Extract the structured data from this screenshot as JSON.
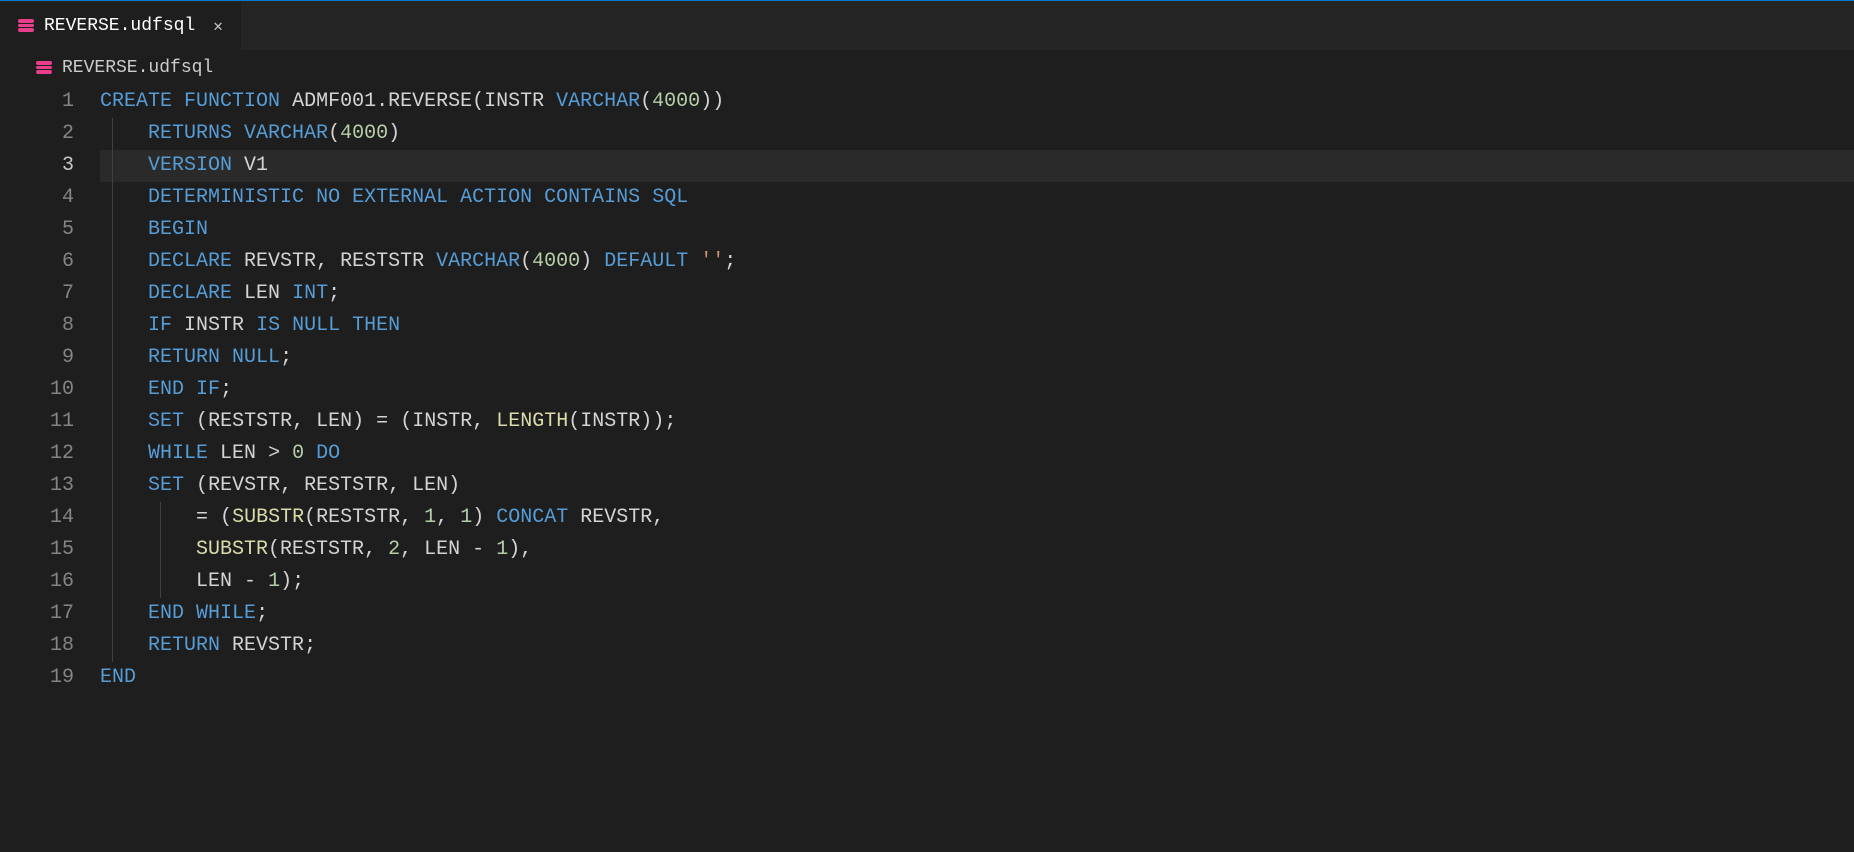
{
  "tab": {
    "filename": "REVERSE.udfsql"
  },
  "breadcrumb": {
    "filename": "REVERSE.udfsql"
  },
  "activeLine": 3,
  "code": {
    "lines": [
      {
        "n": 1,
        "tokens": [
          [
            "kw",
            "CREATE"
          ],
          [
            "sp",
            " "
          ],
          [
            "kw",
            "FUNCTION"
          ],
          [
            "sp",
            " "
          ],
          [
            "id",
            "ADMF001.REVERSE"
          ],
          [
            "punc",
            "("
          ],
          [
            "id",
            "INSTR"
          ],
          [
            "sp",
            " "
          ],
          [
            "ty",
            "VARCHAR"
          ],
          [
            "punc",
            "("
          ],
          [
            "num",
            "4000"
          ],
          [
            "punc",
            ")"
          ],
          [
            "punc",
            ")"
          ]
        ]
      },
      {
        "n": 2,
        "indent": 4,
        "guides": [
          1
        ],
        "tokens": [
          [
            "kw",
            "RETURNS"
          ],
          [
            "sp",
            " "
          ],
          [
            "ty",
            "VARCHAR"
          ],
          [
            "punc",
            "("
          ],
          [
            "num",
            "4000"
          ],
          [
            "punc",
            ")"
          ]
        ]
      },
      {
        "n": 3,
        "indent": 4,
        "guides": [
          1
        ],
        "highlight": true,
        "tokens": [
          [
            "kw",
            "VERSION"
          ],
          [
            "sp",
            " "
          ],
          [
            "id",
            "V1"
          ]
        ]
      },
      {
        "n": 4,
        "indent": 4,
        "guides": [
          1
        ],
        "tokens": [
          [
            "kw",
            "DETERMINISTIC"
          ],
          [
            "sp",
            " "
          ],
          [
            "kw",
            "NO"
          ],
          [
            "sp",
            " "
          ],
          [
            "kw",
            "EXTERNAL"
          ],
          [
            "sp",
            " "
          ],
          [
            "kw",
            "ACTION"
          ],
          [
            "sp",
            " "
          ],
          [
            "kw",
            "CONTAINS"
          ],
          [
            "sp",
            " "
          ],
          [
            "kw",
            "SQL"
          ]
        ]
      },
      {
        "n": 5,
        "indent": 4,
        "guides": [
          1
        ],
        "tokens": [
          [
            "kw",
            "BEGIN"
          ]
        ]
      },
      {
        "n": 6,
        "indent": 4,
        "guides": [
          1
        ],
        "tokens": [
          [
            "kw",
            "DECLARE"
          ],
          [
            "sp",
            " "
          ],
          [
            "id",
            "REVSTR"
          ],
          [
            "punc",
            ","
          ],
          [
            "sp",
            " "
          ],
          [
            "id",
            "RESTSTR"
          ],
          [
            "sp",
            " "
          ],
          [
            "ty",
            "VARCHAR"
          ],
          [
            "punc",
            "("
          ],
          [
            "num",
            "4000"
          ],
          [
            "punc",
            ")"
          ],
          [
            "sp",
            " "
          ],
          [
            "kw",
            "DEFAULT"
          ],
          [
            "sp",
            " "
          ],
          [
            "str",
            "''"
          ],
          [
            "punc",
            ";"
          ]
        ]
      },
      {
        "n": 7,
        "indent": 4,
        "guides": [
          1
        ],
        "tokens": [
          [
            "kw",
            "DECLARE"
          ],
          [
            "sp",
            " "
          ],
          [
            "id",
            "LEN"
          ],
          [
            "sp",
            " "
          ],
          [
            "ty",
            "INT"
          ],
          [
            "punc",
            ";"
          ]
        ]
      },
      {
        "n": 8,
        "indent": 4,
        "guides": [
          1
        ],
        "tokens": [
          [
            "kw",
            "IF"
          ],
          [
            "sp",
            " "
          ],
          [
            "id",
            "INSTR"
          ],
          [
            "sp",
            " "
          ],
          [
            "kw",
            "IS"
          ],
          [
            "sp",
            " "
          ],
          [
            "kw",
            "NULL"
          ],
          [
            "sp",
            " "
          ],
          [
            "kw",
            "THEN"
          ]
        ]
      },
      {
        "n": 9,
        "indent": 4,
        "guides": [
          1
        ],
        "tokens": [
          [
            "kw",
            "RETURN"
          ],
          [
            "sp",
            " "
          ],
          [
            "kw",
            "NULL"
          ],
          [
            "punc",
            ";"
          ]
        ]
      },
      {
        "n": 10,
        "indent": 4,
        "guides": [
          1
        ],
        "tokens": [
          [
            "kw",
            "END"
          ],
          [
            "sp",
            " "
          ],
          [
            "kw",
            "IF"
          ],
          [
            "punc",
            ";"
          ]
        ]
      },
      {
        "n": 11,
        "indent": 4,
        "guides": [
          1
        ],
        "tokens": [
          [
            "kw",
            "SET"
          ],
          [
            "sp",
            " "
          ],
          [
            "punc",
            "("
          ],
          [
            "id",
            "RESTSTR"
          ],
          [
            "punc",
            ","
          ],
          [
            "sp",
            " "
          ],
          [
            "id",
            "LEN"
          ],
          [
            "punc",
            ")"
          ],
          [
            "sp",
            " "
          ],
          [
            "punc",
            "="
          ],
          [
            "sp",
            " "
          ],
          [
            "punc",
            "("
          ],
          [
            "id",
            "INSTR"
          ],
          [
            "punc",
            ","
          ],
          [
            "sp",
            " "
          ],
          [
            "fn",
            "LENGTH"
          ],
          [
            "punc",
            "("
          ],
          [
            "id",
            "INSTR"
          ],
          [
            "punc",
            ")"
          ],
          [
            "punc",
            ")"
          ],
          [
            "punc",
            ";"
          ]
        ]
      },
      {
        "n": 12,
        "indent": 4,
        "guides": [
          1
        ],
        "tokens": [
          [
            "kw",
            "WHILE"
          ],
          [
            "sp",
            " "
          ],
          [
            "id",
            "LEN"
          ],
          [
            "sp",
            " "
          ],
          [
            "punc",
            ">"
          ],
          [
            "sp",
            " "
          ],
          [
            "num",
            "0"
          ],
          [
            "sp",
            " "
          ],
          [
            "kw",
            "DO"
          ]
        ]
      },
      {
        "n": 13,
        "indent": 4,
        "guides": [
          1
        ],
        "tokens": [
          [
            "kw",
            "SET"
          ],
          [
            "sp",
            " "
          ],
          [
            "punc",
            "("
          ],
          [
            "id",
            "REVSTR"
          ],
          [
            "punc",
            ","
          ],
          [
            "sp",
            " "
          ],
          [
            "id",
            "RESTSTR"
          ],
          [
            "punc",
            ","
          ],
          [
            "sp",
            " "
          ],
          [
            "id",
            "LEN"
          ],
          [
            "punc",
            ")"
          ]
        ]
      },
      {
        "n": 14,
        "indent": 8,
        "guides": [
          1,
          2
        ],
        "tokens": [
          [
            "punc",
            "="
          ],
          [
            "sp",
            " "
          ],
          [
            "punc",
            "("
          ],
          [
            "fn",
            "SUBSTR"
          ],
          [
            "punc",
            "("
          ],
          [
            "id",
            "RESTSTR"
          ],
          [
            "punc",
            ","
          ],
          [
            "sp",
            " "
          ],
          [
            "num",
            "1"
          ],
          [
            "punc",
            ","
          ],
          [
            "sp",
            " "
          ],
          [
            "num",
            "1"
          ],
          [
            "punc",
            ")"
          ],
          [
            "sp",
            " "
          ],
          [
            "kw",
            "CONCAT"
          ],
          [
            "sp",
            " "
          ],
          [
            "id",
            "REVSTR"
          ],
          [
            "punc",
            ","
          ]
        ]
      },
      {
        "n": 15,
        "indent": 8,
        "guides": [
          1,
          2
        ],
        "tokens": [
          [
            "fn",
            "SUBSTR"
          ],
          [
            "punc",
            "("
          ],
          [
            "id",
            "RESTSTR"
          ],
          [
            "punc",
            ","
          ],
          [
            "sp",
            " "
          ],
          [
            "num",
            "2"
          ],
          [
            "punc",
            ","
          ],
          [
            "sp",
            " "
          ],
          [
            "id",
            "LEN"
          ],
          [
            "sp",
            " "
          ],
          [
            "punc",
            "-"
          ],
          [
            "sp",
            " "
          ],
          [
            "num",
            "1"
          ],
          [
            "punc",
            ")"
          ],
          [
            "punc",
            ","
          ]
        ]
      },
      {
        "n": 16,
        "indent": 8,
        "guides": [
          1,
          2
        ],
        "tokens": [
          [
            "id",
            "LEN"
          ],
          [
            "sp",
            " "
          ],
          [
            "punc",
            "-"
          ],
          [
            "sp",
            " "
          ],
          [
            "num",
            "1"
          ],
          [
            "punc",
            ")"
          ],
          [
            "punc",
            ";"
          ]
        ]
      },
      {
        "n": 17,
        "indent": 4,
        "guides": [
          1
        ],
        "tokens": [
          [
            "kw",
            "END"
          ],
          [
            "sp",
            " "
          ],
          [
            "kw",
            "WHILE"
          ],
          [
            "punc",
            ";"
          ]
        ]
      },
      {
        "n": 18,
        "indent": 4,
        "guides": [
          1
        ],
        "tokens": [
          [
            "kw",
            "RETURN"
          ],
          [
            "sp",
            " "
          ],
          [
            "id",
            "REVSTR"
          ],
          [
            "punc",
            ";"
          ]
        ]
      },
      {
        "n": 19,
        "tokens": [
          [
            "kw",
            "END"
          ]
        ]
      }
    ]
  }
}
